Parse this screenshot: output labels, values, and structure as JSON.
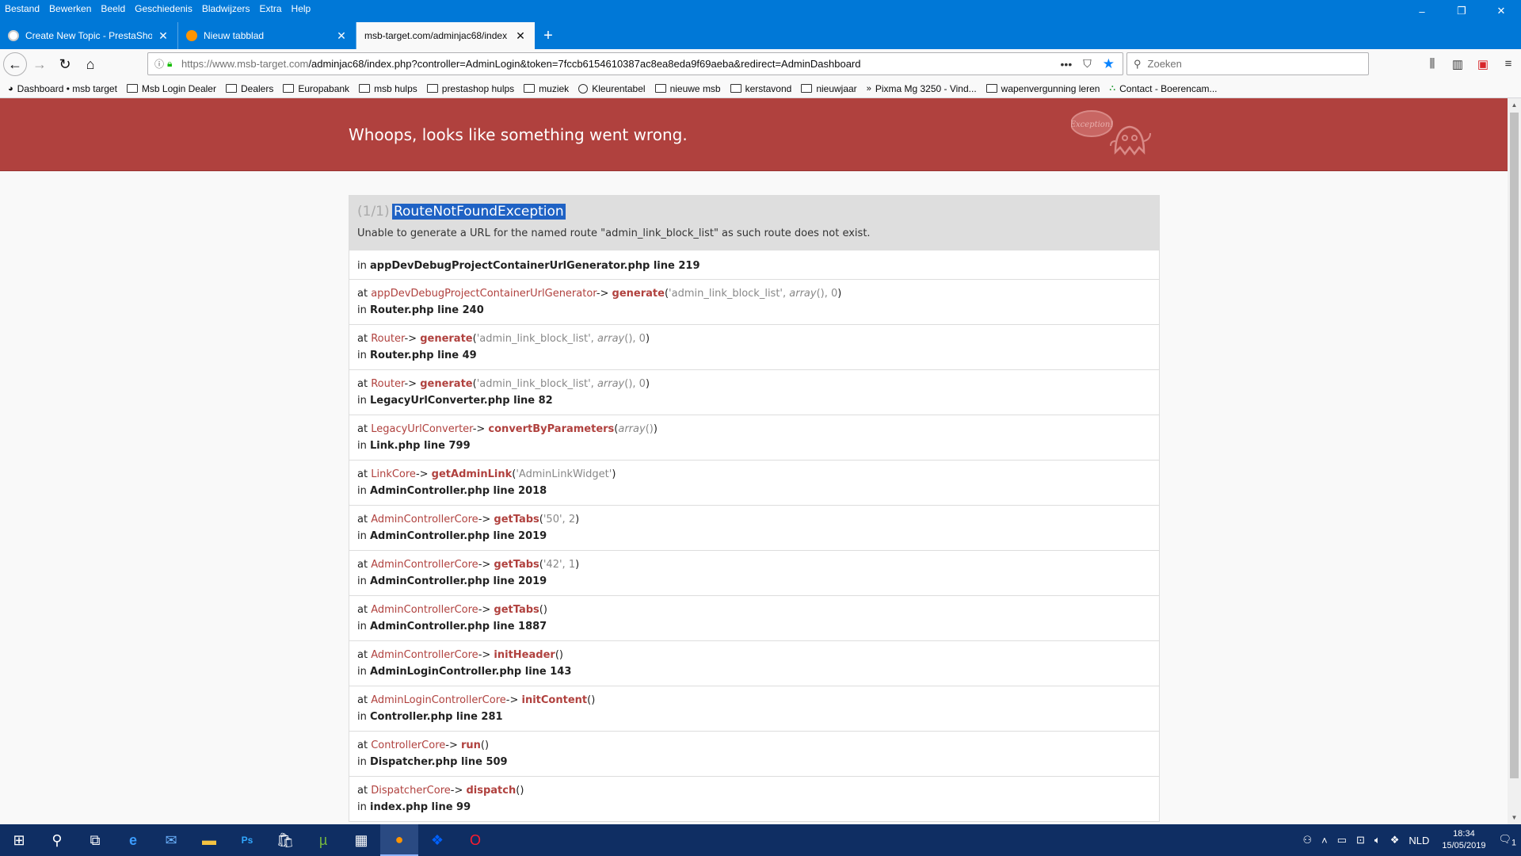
{
  "menu": [
    "Bestand",
    "Bewerken",
    "Beeld",
    "Geschiedenis",
    "Bladwijzers",
    "Extra",
    "Help"
  ],
  "window_controls": {
    "minimize": "–",
    "restore": "❐",
    "close": "✕"
  },
  "tabs": [
    {
      "title": "Create New Topic - PrestaShop",
      "icon": "prestashop-icon",
      "color": "#ffffff"
    },
    {
      "title": "Nieuw tabblad",
      "icon": "firefox-icon",
      "color": "#ff9400"
    },
    {
      "title": "msb-target.com/adminjac68/index",
      "icon": "",
      "color": "#ffffff"
    }
  ],
  "new_tab": "+",
  "nav": {
    "url_host": "https://www.msb-target.com",
    "url_path": "/adminjac68/index.php?controller=AdminLogin&token=7fccb6154610387ac8ea8eda9f69aeba&redirect=AdminDashboard",
    "search_placeholder": "Zoeken",
    "url_more": "•••"
  },
  "bookmarks": [
    {
      "label": "Dashboard • msb target",
      "icon": "prestashop"
    },
    {
      "label": "Msb Login Dealer",
      "icon": "folder"
    },
    {
      "label": "Dealers",
      "icon": "folder"
    },
    {
      "label": "Europabank",
      "icon": "folder"
    },
    {
      "label": "msb hulps",
      "icon": "folder"
    },
    {
      "label": "prestashop hulps",
      "icon": "folder"
    },
    {
      "label": "muziek",
      "icon": "folder"
    },
    {
      "label": "Kleurentabel",
      "icon": "globe"
    },
    {
      "label": "nieuwe msb",
      "icon": "folder"
    },
    {
      "label": "kerstavond",
      "icon": "folder"
    },
    {
      "label": "nieuwjaar",
      "icon": "folder"
    },
    {
      "label": "Pixma Mg 3250 - Vind...",
      "icon": "arrow"
    },
    {
      "label": "wapenvergunning leren",
      "icon": "folder"
    },
    {
      "label": "Contact - Boerencam...",
      "icon": "site"
    }
  ],
  "error": {
    "headline": "Whoops, looks like something went wrong.",
    "counter": "(1/1)",
    "exception": "RouteNotFoundException",
    "message": "Unable to generate a URL for the named route \"admin_link_block_list\" as such route does not exist.",
    "ghost_label": "Exception!",
    "first_location": "appDevDebugProjectContainerUrlGenerator.php line 219",
    "trace": [
      {
        "cls": "appDevDebugProjectContainerUrlGenerator",
        "fn": "generate",
        "args_pre": "'admin_link_block_list', ",
        "args_italic": "array",
        "args_post": "(), 0",
        "loc": "Router.php line 240"
      },
      {
        "cls": "Router",
        "fn": "generate",
        "args_pre": "'admin_link_block_list', ",
        "args_italic": "array",
        "args_post": "(), 0",
        "loc": "Router.php line 49"
      },
      {
        "cls": "Router",
        "fn": "generate",
        "args_pre": "'admin_link_block_list', ",
        "args_italic": "array",
        "args_post": "(), 0",
        "loc": "LegacyUrlConverter.php line 82"
      },
      {
        "cls": "LegacyUrlConverter",
        "fn": "convertByParameters",
        "args_pre": "",
        "args_italic": "array",
        "args_post": "()",
        "loc": "Link.php line 799"
      },
      {
        "cls": "LinkCore",
        "fn": "getAdminLink",
        "args_pre": "'AdminLinkWidget'",
        "args_italic": "",
        "args_post": "",
        "loc": "AdminController.php line 2018"
      },
      {
        "cls": "AdminControllerCore",
        "fn": "getTabs",
        "args_pre": "'50', 2",
        "args_italic": "",
        "args_post": "",
        "loc": "AdminController.php line 2019"
      },
      {
        "cls": "AdminControllerCore",
        "fn": "getTabs",
        "args_pre": "'42', 1",
        "args_italic": "",
        "args_post": "",
        "loc": "AdminController.php line 2019"
      },
      {
        "cls": "AdminControllerCore",
        "fn": "getTabs",
        "args_pre": "",
        "args_italic": "",
        "args_post": "",
        "loc": "AdminController.php line 1887"
      },
      {
        "cls": "AdminControllerCore",
        "fn": "initHeader",
        "args_pre": "",
        "args_italic": "",
        "args_post": "",
        "loc": "AdminLoginController.php line 143"
      },
      {
        "cls": "AdminLoginControllerCore",
        "fn": "initContent",
        "args_pre": "",
        "args_italic": "",
        "args_post": "",
        "loc": "Controller.php line 281"
      },
      {
        "cls": "ControllerCore",
        "fn": "run",
        "args_pre": "",
        "args_italic": "",
        "args_post": "",
        "loc": "Dispatcher.php line 509"
      },
      {
        "cls": "DispatcherCore",
        "fn": "dispatch",
        "args_pre": "",
        "args_italic": "",
        "args_post": "",
        "loc": "index.php line 99"
      }
    ],
    "at_word": "at",
    "in_word": "in",
    "arrow": "->"
  },
  "taskbar": {
    "apps": [
      "windows-start-icon",
      "search-icon",
      "task-view-icon",
      "edge-icon",
      "mail-icon",
      "file-explorer-icon",
      "photoshop-icon",
      "store-icon",
      "utorrent-icon",
      "calculator-icon",
      "firefox-icon",
      "dropbox-icon",
      "opera-icon"
    ],
    "language": "NLD",
    "time": "18:34",
    "date": "15/05/2019",
    "notifications": "1"
  },
  "colors": {
    "titlebar": "#0078d7",
    "error_header": "#b0413e",
    "exception_highlight": "#1f62c4",
    "trace_red": "#b0413e"
  }
}
